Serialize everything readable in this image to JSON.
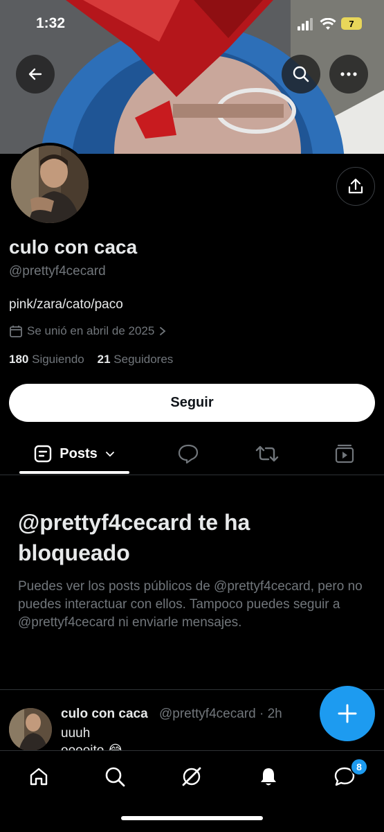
{
  "status_bar": {
    "time": "1:32",
    "battery": "7"
  },
  "profile": {
    "display_name": "culo con caca",
    "handle": "@prettyf4cecard",
    "bio": "pink/zara/cato/paco",
    "joined": "Se unió en abril de 2025",
    "following_count": "180",
    "following_label": "Siguiendo",
    "followers_count": "21",
    "followers_label": "Seguidores",
    "follow_button": "Seguir"
  },
  "tabs": [
    {
      "label": "Posts",
      "icon": "posts-icon",
      "active": true
    },
    {
      "label": "",
      "icon": "replies-icon"
    },
    {
      "label": "",
      "icon": "reposts-icon"
    },
    {
      "label": "",
      "icon": "media-icon"
    }
  ],
  "blocked": {
    "title": "@prettyf4cecard te ha bloqueado",
    "body": "Puedes ver los posts públicos de @prettyf4cecard, pero no puedes interactuar con ellos. Tampoco puedes seguir a @prettyf4cecard ni enviarle mensajes."
  },
  "post": {
    "name": "culo con caca",
    "handle_time": "@prettyf4cecard · 2h",
    "text": "uuuh",
    "text2": "ooooito 😂"
  },
  "nav": {
    "items": [
      "home-icon",
      "search-icon",
      "grok-icon",
      "notifications-icon",
      "messages-icon"
    ],
    "messages_badge": "8"
  },
  "colors": {
    "accent": "#1d9bf0",
    "background": "#000000",
    "muted": "#71767b"
  }
}
